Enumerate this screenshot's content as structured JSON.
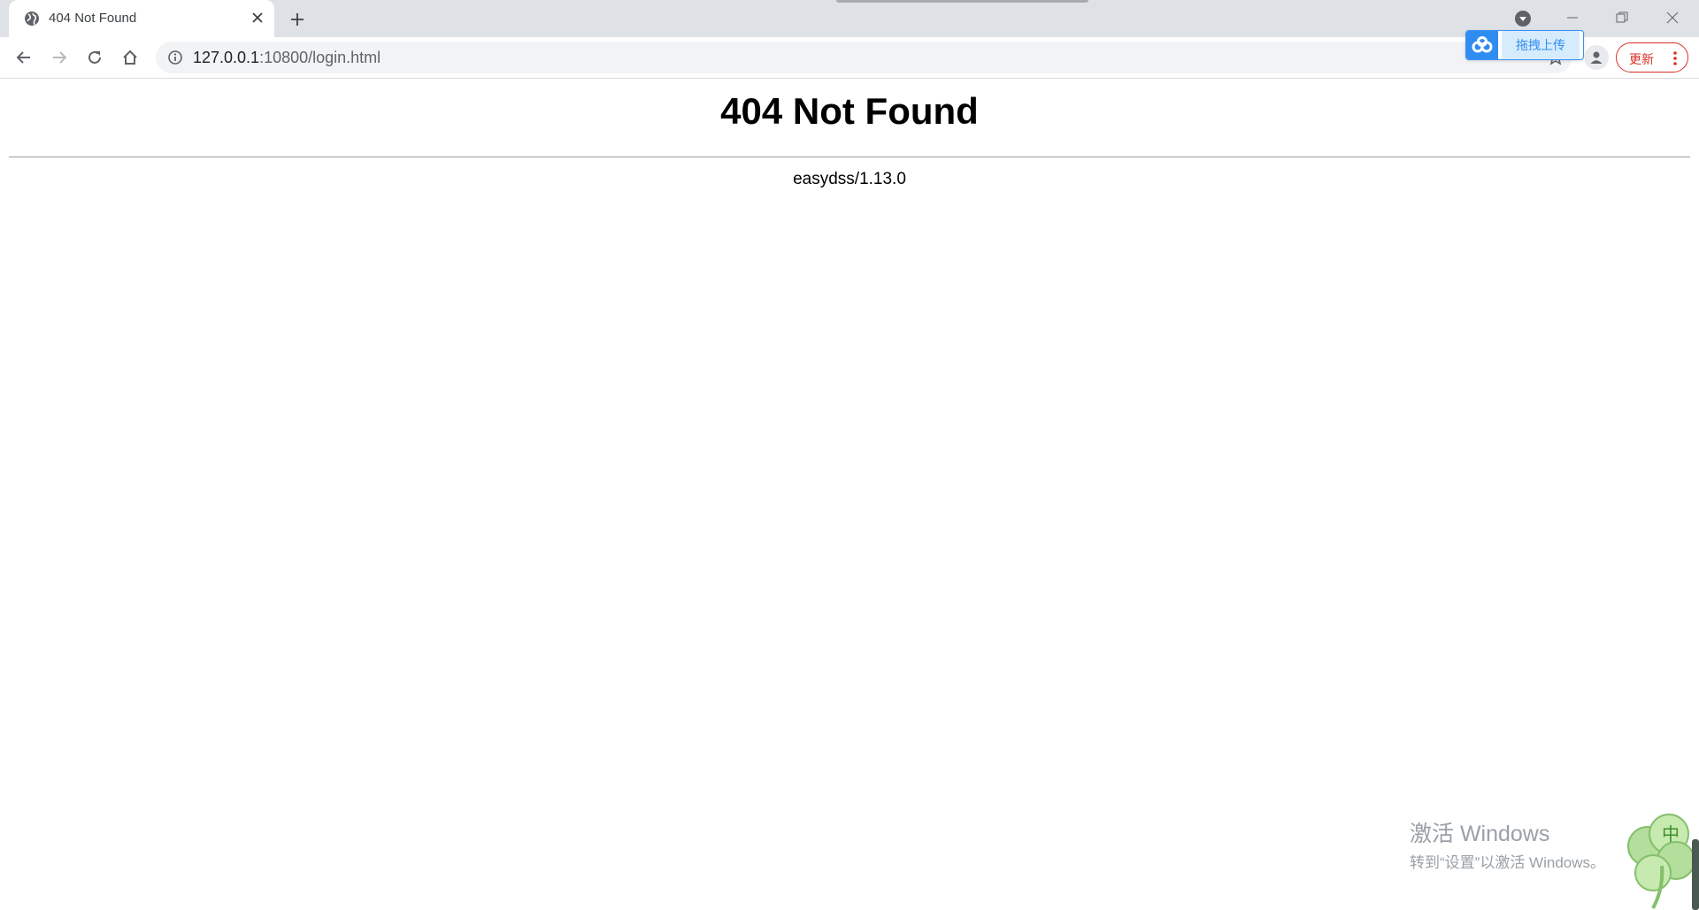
{
  "browser": {
    "tab": {
      "title": "404 Not Found"
    },
    "address": {
      "host": "127.0.0.1",
      "rest": ":10800/login.html"
    },
    "extension": {
      "upload_label": "拖拽上传"
    },
    "update_label": "更新"
  },
  "page": {
    "heading": "404 Not Found",
    "server_signature": "easydss/1.13.0"
  },
  "watermark": {
    "title": "激活 Windows",
    "subtitle": "转到“设置”以激活 Windows。"
  },
  "ime": {
    "label": "中"
  },
  "colors": {
    "tabstrip": "#dee1e6",
    "omnibox": "#f1f3f4",
    "update_accent": "#d93025",
    "extension_blue": "#2f8cf0"
  }
}
